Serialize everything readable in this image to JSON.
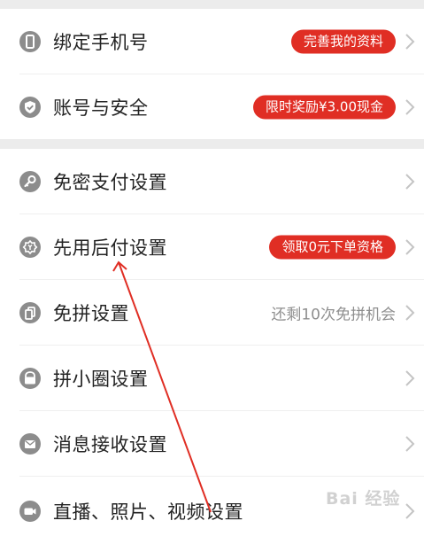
{
  "settings": {
    "bind_phone": {
      "label": "绑定手机号",
      "badge": "完善我的资料",
      "icon": "phone-icon"
    },
    "account_security": {
      "label": "账号与安全",
      "badge": "限时奖励¥3.00现金",
      "icon": "shield-icon"
    },
    "password_free_pay": {
      "label": "免密支付设置",
      "icon": "key-icon"
    },
    "pay_later": {
      "label": "先用后付设置",
      "badge": "领取0元下单资格",
      "icon": "badge-icon"
    },
    "free_group": {
      "label": "免拼设置",
      "hint": "还剩10次免拼机会",
      "icon": "cards-icon"
    },
    "circle": {
      "label": "拼小圈设置",
      "icon": "bag-icon"
    },
    "messages": {
      "label": "消息接收设置",
      "icon": "envelope-icon"
    },
    "media": {
      "label": "直播、照片、视频设置",
      "icon": "camera-icon"
    }
  },
  "watermark": "Bai 经验",
  "colors": {
    "accent": "#e02e24",
    "icon_gray": "#8c8c8c",
    "divider": "#ececec",
    "annotation": "#e02e24"
  }
}
